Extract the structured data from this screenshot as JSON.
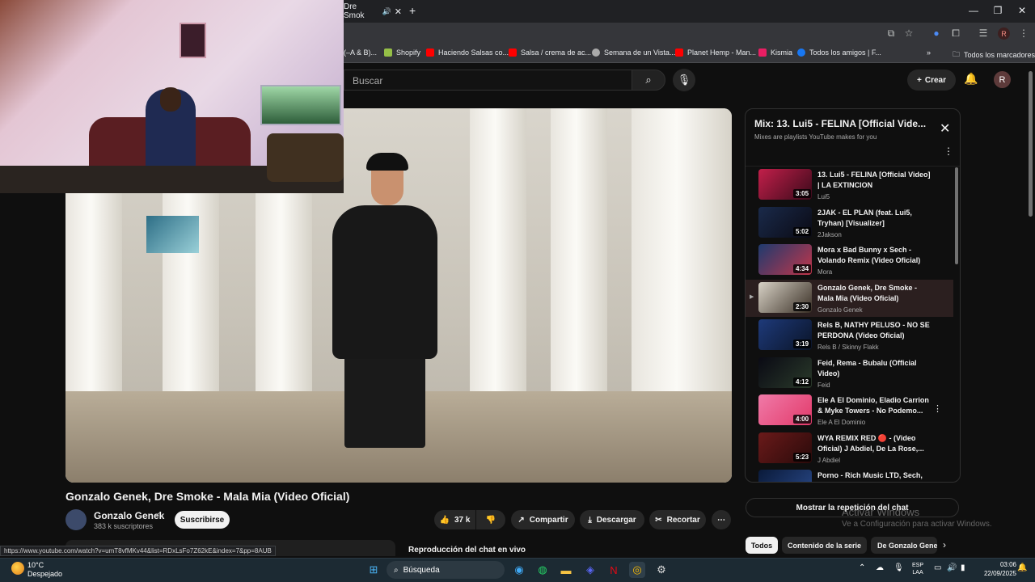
{
  "browser": {
    "tab_title": "Dre Smok",
    "bookmarks": [
      {
        "label": "(–A & B)...",
        "color": "#888888"
      },
      {
        "label": "Shopify",
        "color": "#95bf47"
      },
      {
        "label": "Haciendo Salsas co...",
        "color": "#ff0000"
      },
      {
        "label": "Salsa / crema de ac...",
        "color": "#ff0000"
      },
      {
        "label": "Semana de un Vista...",
        "color": "#aaaaaa"
      },
      {
        "label": "Planet Hemp - Man...",
        "color": "#ff0000"
      },
      {
        "label": "Kismia",
        "color": "#e91e63"
      },
      {
        "label": "Todos los amigos | F...",
        "color": "#1877f2"
      }
    ],
    "all_bookmarks": "Todos los marcadores",
    "avatar_letter": "R"
  },
  "header": {
    "search_placeholder": "Buscar",
    "create_label": "Crear",
    "avatar_letter": "R"
  },
  "video": {
    "title": "Gonzalo Genek, Dre Smoke - Mala Mia (Video Oficial)",
    "channel": "Gonzalo Genek",
    "subscribers": "383 k suscriptores",
    "subscribe_label": "Suscribirse",
    "likes": "37 k",
    "share_label": "Compartir",
    "download_label": "Descargar",
    "clip_label": "Recortar",
    "live_chat_label": "Reproducción del chat en vivo",
    "status_url": "https://www.youtube.com/watch?v=umT8vfMKv44&list=RDxLsFo7Z62kE&index=7&pp=8AUB"
  },
  "playlist": {
    "title": "Mix: 13. Lui5 - FELINA [Official Vide...",
    "subtitle": "Mixes are playlists YouTube makes for you",
    "items": [
      {
        "title": "13. Lui5 - FELINA [Official Video] | LA EXTINCION",
        "artist": "Lui5",
        "duration": "3:05",
        "color1": "#c21f4a",
        "color2": "#3a0a1a",
        "active": false
      },
      {
        "title": "2JAK - EL PLAN (feat. Lui5, Tryhan) [Visualizer]",
        "artist": "2Jakson",
        "duration": "5:02",
        "color1": "#1a2a4a",
        "color2": "#0a0a14",
        "active": false
      },
      {
        "title": "Mora x Bad Bunny x Sech - Volando Remix (Video Oficial)",
        "artist": "Mora",
        "duration": "4:34",
        "color1": "#1e3a6e",
        "color2": "#c2364a",
        "active": false
      },
      {
        "title": "Gonzalo Genek, Dre Smoke - Mala Mia (Video Oficial)",
        "artist": "Gonzalo Genek",
        "duration": "2:30",
        "color1": "#d8d2c6",
        "color2": "#3a3026",
        "active": true
      },
      {
        "title": "Rels B, NATHY PELUSO - NO SE PERDONA (Video Oficial)",
        "artist": "Rels B / Skinny Flakk",
        "duration": "3:19",
        "color1": "#1e3a7a",
        "color2": "#0a1428",
        "active": false
      },
      {
        "title": "Feid, Rema - Bubalu (Official Video)",
        "artist": "Feid",
        "duration": "4:12",
        "color1": "#0a0a14",
        "color2": "#2a3a2a",
        "active": false
      },
      {
        "title": "Ele A El Dominio, Eladio Carrion & Myke Towers - No Podemo...",
        "artist": "Ele A El Dominio",
        "duration": "4:00",
        "color1": "#f07aa8",
        "color2": "#e23a6a",
        "active": false
      },
      {
        "title": "WYA REMIX RED 🔴 - (Video Oficial) J Abdiel, De La Rose,...",
        "artist": "J Abdiel",
        "duration": "5:23",
        "color1": "#6a1a1a",
        "color2": "#2a0a0a",
        "active": false
      },
      {
        "title": "Porno - Rich Music LTD, Sech, Dalex ft. Justin Quiles, Lenny...",
        "artist": "",
        "duration": "",
        "color1": "#0a1a3a",
        "color2": "#2a4a8a",
        "active": false
      }
    ],
    "show_chat_label": "Mostrar la repetición del chat"
  },
  "chips": [
    "Todos",
    "Contenido de la serie",
    "De Gonzalo Genek"
  ],
  "activation": {
    "title": "Activar Windows",
    "subtitle": "Ve a Configuración para activar Windows."
  },
  "taskbar": {
    "temperature": "10°C",
    "weather": "Despejado",
    "search_label": "Búsqueda",
    "lang_1": "ESP",
    "lang_2": "LAA",
    "time": "03:06",
    "date": "22/09/2025"
  }
}
